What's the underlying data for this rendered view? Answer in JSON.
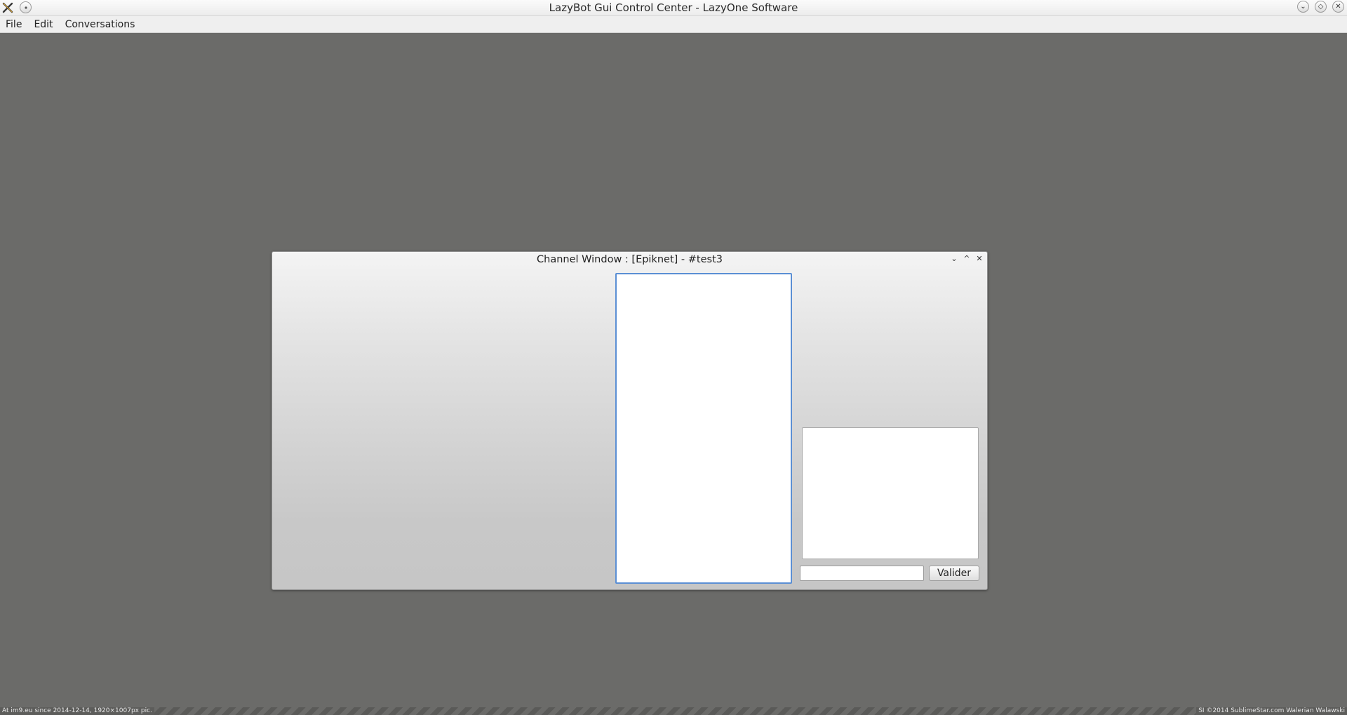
{
  "app": {
    "title": "LazyBot Gui Control Center - LazyOne Software"
  },
  "titlebar": {
    "left_icons": [
      "app-icon",
      "pin-icon"
    ],
    "right_icons": [
      "minimize-icon",
      "maximize-icon",
      "close-icon"
    ],
    "minimize_glyph": "⌄",
    "maximize_glyph": "◇",
    "close_glyph": "✕"
  },
  "menubar": {
    "items": [
      "File",
      "Edit",
      "Conversations"
    ]
  },
  "channel_window": {
    "title": "Channel Window : [Epiknet] - #test3",
    "controls": {
      "minimize": "⌄",
      "maximize": "^",
      "close": "✕"
    },
    "message_input": {
      "value": "",
      "placeholder": ""
    },
    "submit_button": "Valider"
  },
  "footer": {
    "left": "At im9.eu since 2014-12-14, 1920×1007px pic.",
    "right": "SI ©2014 SublimeStar.com Walerian Walawski"
  },
  "colors": {
    "workspace": "#6b6b69",
    "focus_border": "#5b8fd4"
  }
}
